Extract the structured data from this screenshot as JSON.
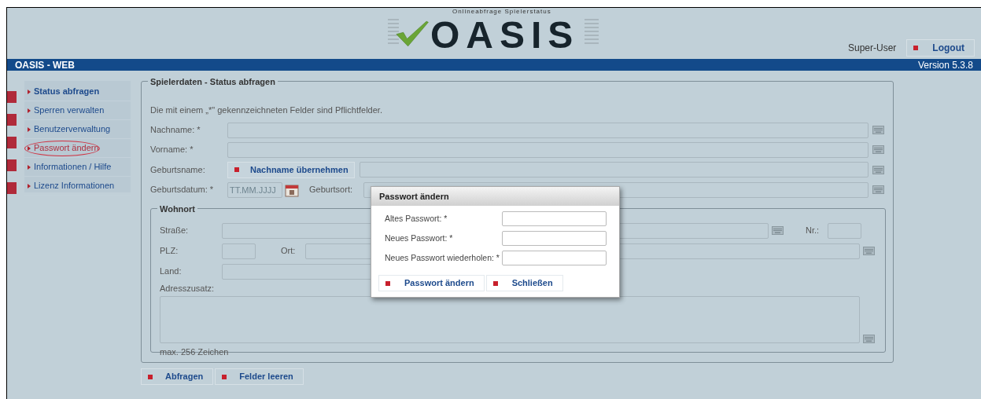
{
  "header": {
    "logo_title": "OASIS",
    "logo_tagline": "Onlineabfrage Spielerstatus",
    "user": "Super-User",
    "logout_button": "Logout"
  },
  "title_bar": {
    "app_name": "OASIS - WEB",
    "version": "Version 5.3.8"
  },
  "sidebar": {
    "items": [
      {
        "label": "Status abfragen",
        "selected": true,
        "circled": false
      },
      {
        "label": "Sperren verwalten",
        "selected": false,
        "circled": false
      },
      {
        "label": "Benutzerverwaltung",
        "selected": false,
        "circled": false
      },
      {
        "label": "Passwort ändern",
        "selected": false,
        "circled": true
      },
      {
        "label": "Informationen / Hilfe",
        "selected": false,
        "circled": false
      },
      {
        "label": "Lizenz Informationen",
        "selected": false,
        "circled": false
      }
    ]
  },
  "form": {
    "legend": "Spielerdaten - Status abfragen",
    "hint": "Die mit einem „*\" gekennzeichneten Felder sind Pflichtfelder.",
    "rows": [
      {
        "kind": "text",
        "label": "Nachname: *"
      },
      {
        "kind": "text",
        "label": "Vorname: *"
      },
      {
        "kind": "copy",
        "label": "Geburtsname:",
        "button": "Nachname übernehmen"
      },
      {
        "kind": "date",
        "label": "Geburtsdatum: *",
        "placeholder": "TT.MM.JJJJ",
        "second_label": "Geburtsort:"
      }
    ],
    "address": {
      "legend": "Wohnort",
      "street_label": "Straße:",
      "number_label": "Nr.:",
      "zip_label": "PLZ:",
      "city_label": "Ort:",
      "country_label": "Land:",
      "extra_label": "Adresszusatz:",
      "extra_limit": "max. 256 Zeichen"
    },
    "buttons": [
      "Abfragen",
      "Felder leeren"
    ]
  },
  "dialog": {
    "title": "Passwort ändern",
    "fields": [
      {
        "label": "Altes Passwort: *"
      },
      {
        "label": "Neues Passwort: *"
      },
      {
        "label": "Neues Passwort wiederholen: *"
      }
    ],
    "buttons": [
      "Passwort ändern",
      "Schließen"
    ]
  }
}
